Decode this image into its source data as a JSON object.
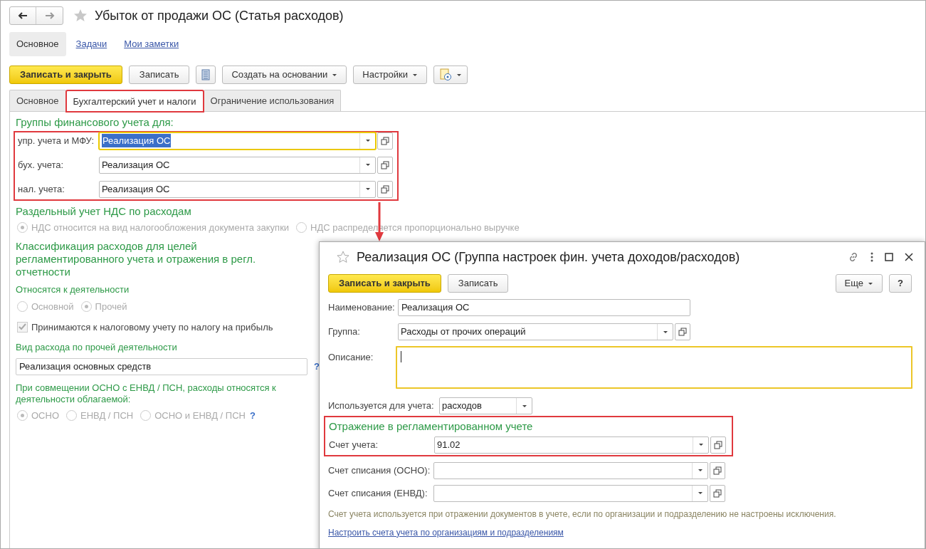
{
  "window": {
    "title": "Убыток от продажи ОС (Статья расходов)"
  },
  "sections": [
    {
      "label": "Основное",
      "selected": true
    },
    {
      "label": "Задачи",
      "selected": false
    },
    {
      "label": "Мои заметки",
      "selected": false
    }
  ],
  "toolbar": [
    {
      "kind": "primary",
      "label": "Записать и закрыть"
    },
    {
      "kind": "button",
      "label": "Записать"
    },
    {
      "kind": "icon"
    },
    {
      "kind": "menu",
      "label": "Создать на основании"
    },
    {
      "kind": "menu",
      "label": "Настройки"
    },
    {
      "kind": "iconmenu"
    }
  ],
  "tabs": [
    {
      "label": "Основное",
      "selected": false,
      "highlighted": false
    },
    {
      "label": "Бухгалтерский учет и налоги",
      "selected": true,
      "highlighted": true
    },
    {
      "label": "Ограничение использования",
      "selected": false,
      "highlighted": false
    }
  ],
  "groups": {
    "heading": "Группы финансового учета для:",
    "highlighted": true,
    "fields": [
      {
        "label": "упр. учета и МФУ:",
        "value": "Реализация ОС",
        "focused": true
      },
      {
        "label": "бух. учета:",
        "value": "Реализация ОС",
        "focused": false
      },
      {
        "label": "нал. учета:",
        "value": "Реализация ОС",
        "focused": false
      }
    ]
  },
  "vat": {
    "heading": "Раздельный учет НДС по расходам",
    "options": [
      {
        "label": "НДС относится на вид налогообложения документа закупки",
        "selected": true
      },
      {
        "label": "НДС распределяется пропорционально выручке",
        "selected": false
      }
    ]
  },
  "classification": {
    "heading": "Классификация расходов для целей регламентированного учета и отражения в регл. отчетности",
    "activity": {
      "label": "Относятся к деятельности",
      "options": [
        {
          "label": "Основной",
          "selected": false
        },
        {
          "label": "Прочей",
          "selected": true
        }
      ]
    },
    "tax_profit": {
      "label": "Принимаются к налоговому учету по налогу на прибыль",
      "checked": true
    },
    "expense_type": {
      "label": "Вид расхода по прочей деятельности",
      "value": "Реализация основных средств",
      "help": "?"
    },
    "combined": {
      "label": "При совмещении ОСНО с ЕНВД / ПСН, расходы относятся к деятельности облагаемой:",
      "options": [
        {
          "label": "ОСНО",
          "selected": true
        },
        {
          "label": "ЕНВД / ПСН",
          "selected": false
        },
        {
          "label": "ОСНО и ЕНВД / ПСН",
          "selected": false
        }
      ],
      "help": "?"
    }
  },
  "dialog": {
    "title": "Реализация ОС (Группа настроек фин. учета доходов/расходов)",
    "buttons": [
      {
        "kind": "primary",
        "label": "Записать и закрыть"
      },
      {
        "kind": "button",
        "label": "Записать"
      }
    ],
    "more": "Еще",
    "help": "?",
    "name": {
      "label": "Наименование:",
      "value": "Реализация ОС"
    },
    "group": {
      "label": "Группа:",
      "value": "Расходы от прочих операций"
    },
    "description": {
      "label": "Описание:",
      "focused": true
    },
    "used_for": {
      "label": "Используется для учета:",
      "value": "расходов"
    },
    "regulated": {
      "heading": "Отражение в регламентированном учете",
      "highlighted": true,
      "account": {
        "label": "Счет учета:",
        "value": "91.02"
      }
    },
    "write_off": [
      {
        "label": "Счет списания (ОСНО):"
      },
      {
        "label": "Счет списания (ЕНВД):"
      }
    ],
    "note": "Счет учета используется при отражении документов в учете, если по организации и подразделению не настроены исключения.",
    "link": "Настроить счета учета по организациям и подразделениям"
  }
}
